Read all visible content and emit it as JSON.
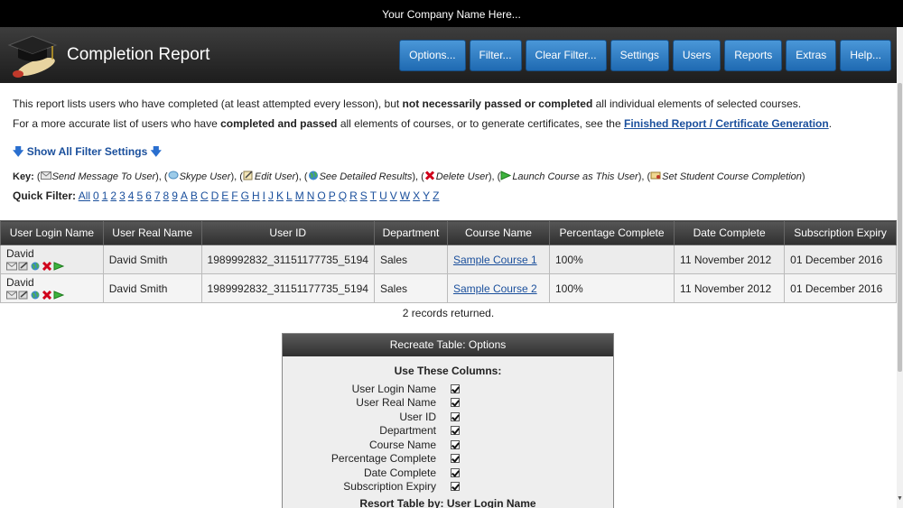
{
  "topbar": {
    "company": "Your Company Name Here..."
  },
  "header": {
    "title": "Completion Report",
    "nav": [
      "Options...",
      "Filter...",
      "Clear Filter...",
      "Settings",
      "Users",
      "Reports",
      "Extras",
      "Help..."
    ]
  },
  "intro": {
    "p1_a": "This report lists users who have completed (at least attempted every lesson), but ",
    "p1_b": "not necessarily passed or completed",
    "p1_c": " all individual elements of selected courses.",
    "p2_a": "For a more accurate list of users who have ",
    "p2_b": "completed and passed",
    "p2_c": " all elements of courses, or to generate certificates, see the ",
    "p2_link": "Finished Report / Certificate Generation",
    "p2_d": "."
  },
  "filter_toggle": "Show All Filter Settings",
  "key": {
    "label": "Key:",
    "items": [
      "Send Message To User",
      "Skype User",
      "Edit User",
      "See Detailed Results",
      "Delete User",
      "Launch Course as This User",
      "Set Student Course Completion"
    ]
  },
  "quick_filter": {
    "label": "Quick Filter:",
    "letters": [
      "All",
      "0",
      "1",
      "2",
      "3",
      "4",
      "5",
      "6",
      "7",
      "8",
      "9",
      "A",
      "B",
      "C",
      "D",
      "E",
      "F",
      "G",
      "H",
      "I",
      "J",
      "K",
      "L",
      "M",
      "N",
      "O",
      "P",
      "Q",
      "R",
      "S",
      "T",
      "U",
      "V",
      "W",
      "X",
      "Y",
      "Z"
    ]
  },
  "table": {
    "headers": [
      "User Login Name",
      "User Real Name",
      "User ID",
      "Department",
      "Course Name",
      "Percentage Complete",
      "Date Complete",
      "Subscription Expiry"
    ],
    "rows": [
      {
        "login": "David",
        "real": "David Smith",
        "id": "1989992832_31151177735_5194",
        "dept": "Sales",
        "course": "Sample Course 1",
        "pct": "100%",
        "date": "11 November 2012",
        "expiry": "01 December 2016"
      },
      {
        "login": "David",
        "real": "David Smith",
        "id": "1989992832_31151177735_5194",
        "dept": "Sales",
        "course": "Sample Course 2",
        "pct": "100%",
        "date": "11 November 2012",
        "expiry": "01 December 2016"
      }
    ],
    "records": "2 records returned."
  },
  "options_panel": {
    "title": "Recreate Table: Options",
    "subtitle": "Use These Columns:",
    "columns": [
      "User Login Name",
      "User Real Name",
      "User ID",
      "Department",
      "Course Name",
      "Percentage Complete",
      "Date Complete",
      "Subscription Expiry"
    ],
    "cut_text": "Resort Table by: User Login Name"
  },
  "colors": {
    "nav_button": "#2f7fc6",
    "link": "#1a4f9c",
    "header_bg": "#2a2a2a"
  }
}
